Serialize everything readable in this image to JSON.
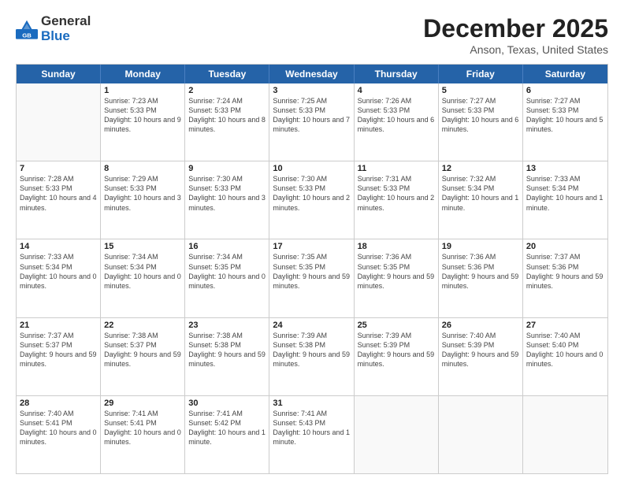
{
  "header": {
    "logo_general": "General",
    "logo_blue": "Blue",
    "month_title": "December 2025",
    "location": "Anson, Texas, United States"
  },
  "days_of_week": [
    "Sunday",
    "Monday",
    "Tuesday",
    "Wednesday",
    "Thursday",
    "Friday",
    "Saturday"
  ],
  "weeks": [
    [
      {
        "day": "",
        "empty": true
      },
      {
        "day": "1",
        "sunrise": "7:23 AM",
        "sunset": "5:33 PM",
        "daylight": "10 hours and 9 minutes."
      },
      {
        "day": "2",
        "sunrise": "7:24 AM",
        "sunset": "5:33 PM",
        "daylight": "10 hours and 8 minutes."
      },
      {
        "day": "3",
        "sunrise": "7:25 AM",
        "sunset": "5:33 PM",
        "daylight": "10 hours and 7 minutes."
      },
      {
        "day": "4",
        "sunrise": "7:26 AM",
        "sunset": "5:33 PM",
        "daylight": "10 hours and 6 minutes."
      },
      {
        "day": "5",
        "sunrise": "7:27 AM",
        "sunset": "5:33 PM",
        "daylight": "10 hours and 6 minutes."
      },
      {
        "day": "6",
        "sunrise": "7:27 AM",
        "sunset": "5:33 PM",
        "daylight": "10 hours and 5 minutes."
      }
    ],
    [
      {
        "day": "7",
        "sunrise": "7:28 AM",
        "sunset": "5:33 PM",
        "daylight": "10 hours and 4 minutes."
      },
      {
        "day": "8",
        "sunrise": "7:29 AM",
        "sunset": "5:33 PM",
        "daylight": "10 hours and 3 minutes."
      },
      {
        "day": "9",
        "sunrise": "7:30 AM",
        "sunset": "5:33 PM",
        "daylight": "10 hours and 3 minutes."
      },
      {
        "day": "10",
        "sunrise": "7:30 AM",
        "sunset": "5:33 PM",
        "daylight": "10 hours and 2 minutes."
      },
      {
        "day": "11",
        "sunrise": "7:31 AM",
        "sunset": "5:33 PM",
        "daylight": "10 hours and 2 minutes."
      },
      {
        "day": "12",
        "sunrise": "7:32 AM",
        "sunset": "5:34 PM",
        "daylight": "10 hours and 1 minute."
      },
      {
        "day": "13",
        "sunrise": "7:33 AM",
        "sunset": "5:34 PM",
        "daylight": "10 hours and 1 minute."
      }
    ],
    [
      {
        "day": "14",
        "sunrise": "7:33 AM",
        "sunset": "5:34 PM",
        "daylight": "10 hours and 0 minutes."
      },
      {
        "day": "15",
        "sunrise": "7:34 AM",
        "sunset": "5:34 PM",
        "daylight": "10 hours and 0 minutes."
      },
      {
        "day": "16",
        "sunrise": "7:34 AM",
        "sunset": "5:35 PM",
        "daylight": "10 hours and 0 minutes."
      },
      {
        "day": "17",
        "sunrise": "7:35 AM",
        "sunset": "5:35 PM",
        "daylight": "9 hours and 59 minutes."
      },
      {
        "day": "18",
        "sunrise": "7:36 AM",
        "sunset": "5:35 PM",
        "daylight": "9 hours and 59 minutes."
      },
      {
        "day": "19",
        "sunrise": "7:36 AM",
        "sunset": "5:36 PM",
        "daylight": "9 hours and 59 minutes."
      },
      {
        "day": "20",
        "sunrise": "7:37 AM",
        "sunset": "5:36 PM",
        "daylight": "9 hours and 59 minutes."
      }
    ],
    [
      {
        "day": "21",
        "sunrise": "7:37 AM",
        "sunset": "5:37 PM",
        "daylight": "9 hours and 59 minutes."
      },
      {
        "day": "22",
        "sunrise": "7:38 AM",
        "sunset": "5:37 PM",
        "daylight": "9 hours and 59 minutes."
      },
      {
        "day": "23",
        "sunrise": "7:38 AM",
        "sunset": "5:38 PM",
        "daylight": "9 hours and 59 minutes."
      },
      {
        "day": "24",
        "sunrise": "7:39 AM",
        "sunset": "5:38 PM",
        "daylight": "9 hours and 59 minutes."
      },
      {
        "day": "25",
        "sunrise": "7:39 AM",
        "sunset": "5:39 PM",
        "daylight": "9 hours and 59 minutes."
      },
      {
        "day": "26",
        "sunrise": "7:40 AM",
        "sunset": "5:39 PM",
        "daylight": "9 hours and 59 minutes."
      },
      {
        "day": "27",
        "sunrise": "7:40 AM",
        "sunset": "5:40 PM",
        "daylight": "10 hours and 0 minutes."
      }
    ],
    [
      {
        "day": "28",
        "sunrise": "7:40 AM",
        "sunset": "5:41 PM",
        "daylight": "10 hours and 0 minutes."
      },
      {
        "day": "29",
        "sunrise": "7:41 AM",
        "sunset": "5:41 PM",
        "daylight": "10 hours and 0 minutes."
      },
      {
        "day": "30",
        "sunrise": "7:41 AM",
        "sunset": "5:42 PM",
        "daylight": "10 hours and 1 minute."
      },
      {
        "day": "31",
        "sunrise": "7:41 AM",
        "sunset": "5:43 PM",
        "daylight": "10 hours and 1 minute."
      },
      {
        "day": "",
        "empty": true
      },
      {
        "day": "",
        "empty": true
      },
      {
        "day": "",
        "empty": true
      }
    ]
  ]
}
